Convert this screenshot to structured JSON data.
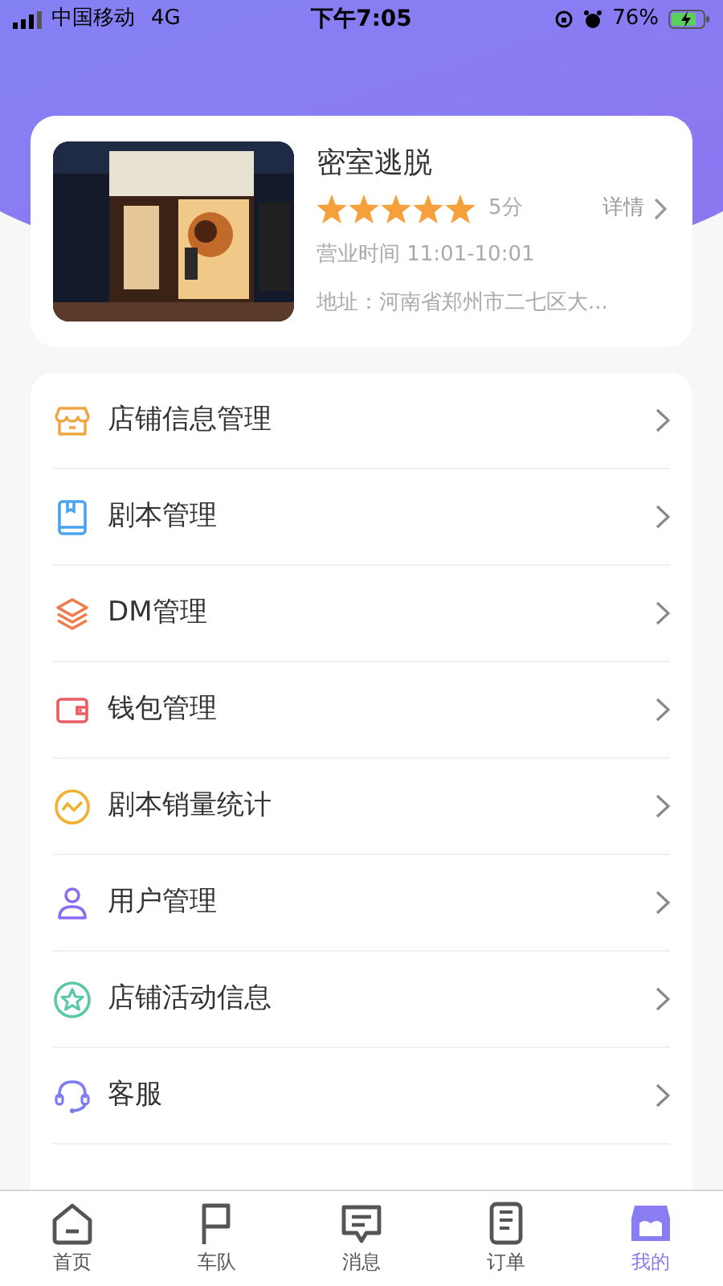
{
  "status_bar": {
    "carrier": "中国移动",
    "network": "4G",
    "time": "下午7:05",
    "battery": "76%"
  },
  "shop": {
    "name": "密室逃脱",
    "stars": 5,
    "score": "5分",
    "details_link": "详情",
    "hours": "营业时间 11:01-10:01",
    "address": "地址：河南省郑州市二七区大..."
  },
  "menu": [
    {
      "label": "店铺信息管理"
    },
    {
      "label": "剧本管理"
    },
    {
      "label": "DM管理"
    },
    {
      "label": "钱包管理"
    },
    {
      "label": "剧本销量统计"
    },
    {
      "label": "用户管理"
    },
    {
      "label": "店铺活动信息"
    },
    {
      "label": "客服"
    }
  ],
  "tabs": [
    {
      "label": "首页",
      "selected": false
    },
    {
      "label": "车队",
      "selected": false
    },
    {
      "label": "消息",
      "selected": false
    },
    {
      "label": "订单",
      "selected": false
    },
    {
      "label": "我的",
      "selected": true
    }
  ]
}
